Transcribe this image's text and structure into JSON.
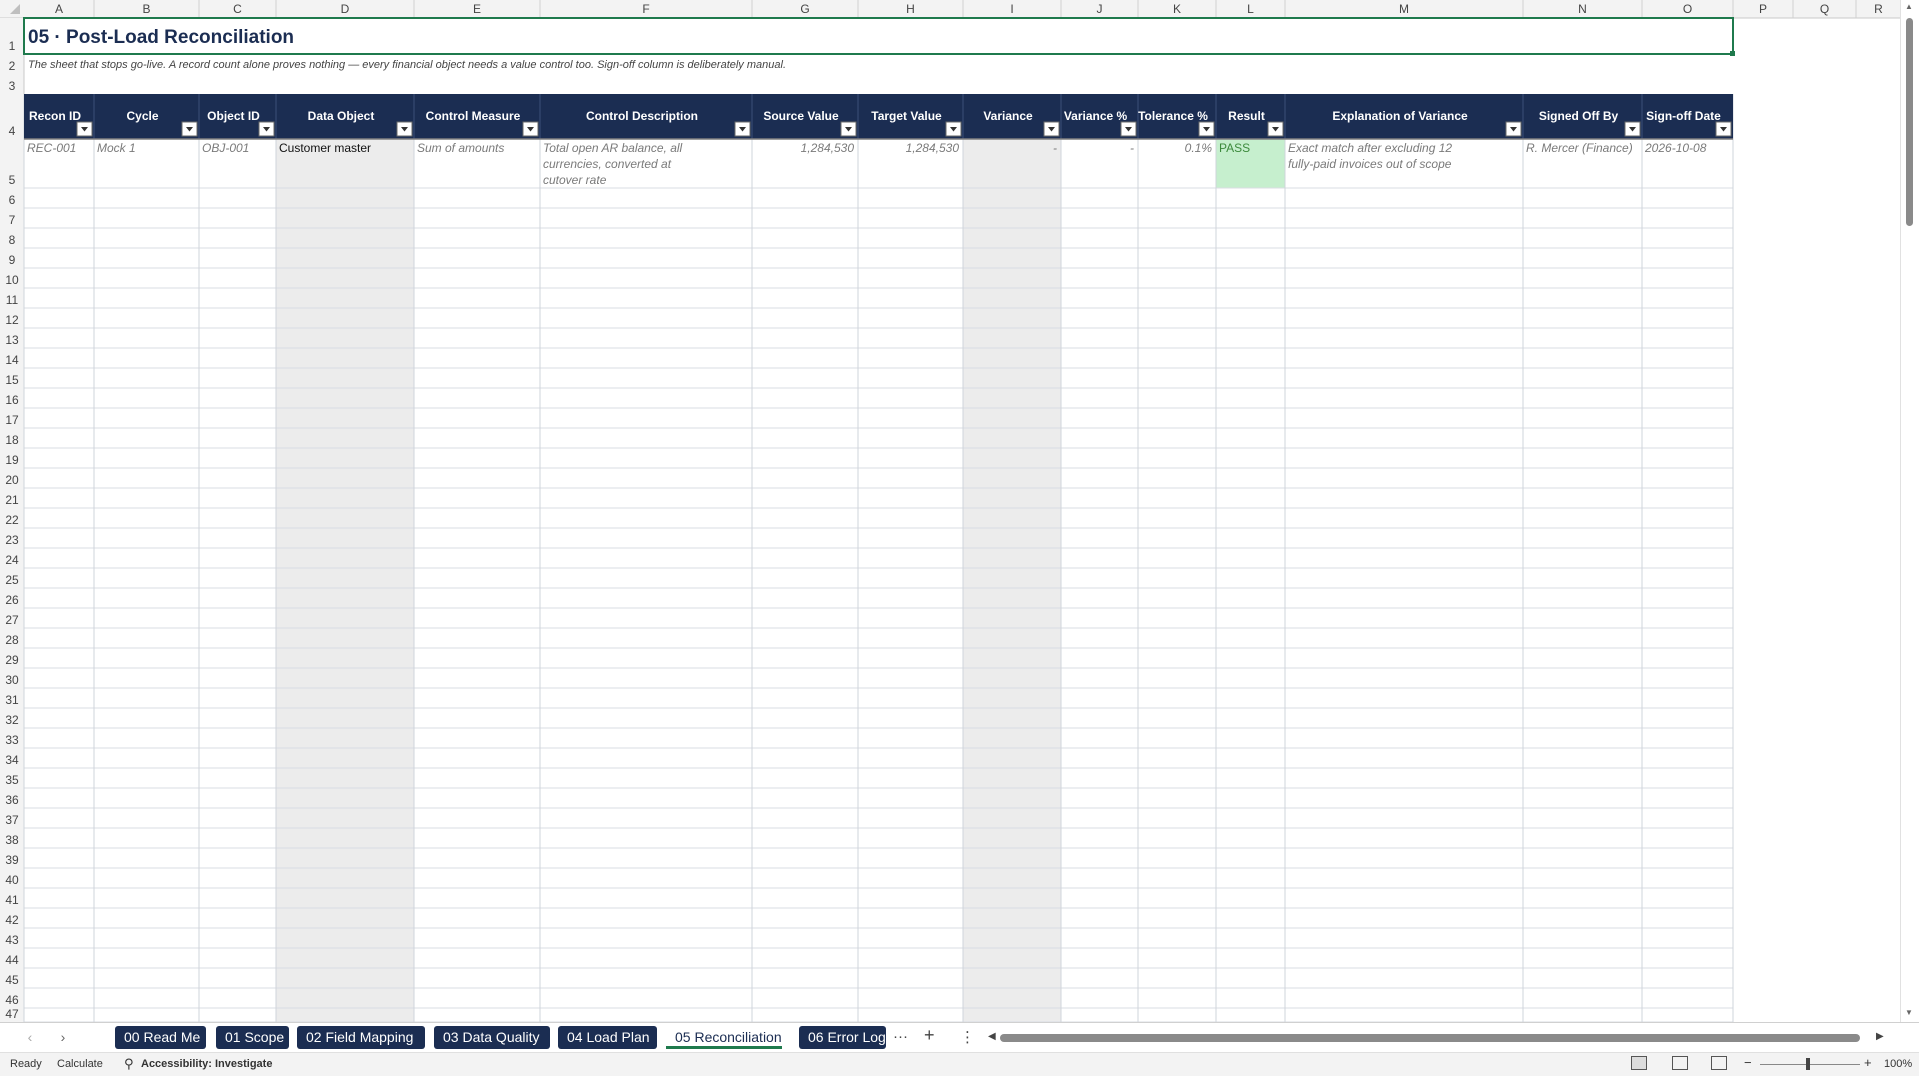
{
  "columns": [
    "A",
    "B",
    "C",
    "D",
    "E",
    "F",
    "G",
    "H",
    "I",
    "J",
    "K",
    "L",
    "M",
    "N",
    "O",
    "P",
    "Q",
    "R"
  ],
  "sheet": {
    "title": "05 · Post-Load Reconciliation",
    "subtitle": "The sheet that stops go-live. A record count alone proves nothing — every financial object needs a value control too. Sign-off column is deliberately manual.",
    "headers": [
      "Recon ID",
      "Cycle",
      "Object ID",
      "Data Object",
      "Control Measure",
      "Control Description",
      "Source Value",
      "Target Value",
      "Variance",
      "Variance %",
      "Tolerance %",
      "Result",
      "Explanation of Variance",
      "Signed Off By",
      "Sign-off Date"
    ],
    "rows": [
      [
        "REC-001",
        "Mock 1",
        "OBJ-001",
        "Customer master",
        "Sum of amounts",
        "Total open AR balance, all currencies, converted at cutover rate",
        "1,284,530",
        "1,284,530",
        "-",
        "-",
        "0.1%",
        "PASS",
        "Exact match after excluding 12 fully-paid invoices out of scope",
        "R. Mercer (Finance)",
        "2026-10-08"
      ]
    ],
    "visible_row_numbers": [
      "1",
      "2",
      "3",
      "4",
      "5",
      "6",
      "7",
      "8",
      "9",
      "10",
      "11",
      "12",
      "13",
      "14",
      "15",
      "16",
      "17",
      "18",
      "19",
      "20",
      "21",
      "22",
      "23",
      "24",
      "25",
      "26",
      "27",
      "28",
      "29",
      "30",
      "31",
      "32",
      "33",
      "34",
      "35",
      "36",
      "37",
      "38",
      "39",
      "40",
      "41",
      "42",
      "43",
      "44",
      "45",
      "46",
      "47"
    ]
  },
  "colors": {
    "header_bg": "#1b2d52",
    "header_text": "#ffffff",
    "title_text": "#1b2d52",
    "computed_col_bg": "#ececec",
    "pass_bg": "#c6efce",
    "pass_text": "#3c8a3c",
    "grid": "#d9dde3",
    "selection": "#1f7a4d"
  },
  "tabs": [
    {
      "label": "00 Read Me",
      "active": false
    },
    {
      "label": "01 Scope",
      "active": false
    },
    {
      "label": "02 Field Mapping",
      "active": false
    },
    {
      "label": "03 Data Quality",
      "active": false
    },
    {
      "label": "04 Load Plan",
      "active": false
    },
    {
      "label": "05 Reconciliation",
      "active": true
    },
    {
      "label": "06 Error Log",
      "active": false
    }
  ],
  "tabbar": {
    "more": "···",
    "add": "+",
    "options": "⋮",
    "prev": "‹",
    "next": "›"
  },
  "status": {
    "ready": "Ready",
    "calculate": "Calculate",
    "accessibility": "Accessibility: Investigate",
    "zoom_minus": "−",
    "zoom_plus": "+",
    "zoom": "100%"
  }
}
